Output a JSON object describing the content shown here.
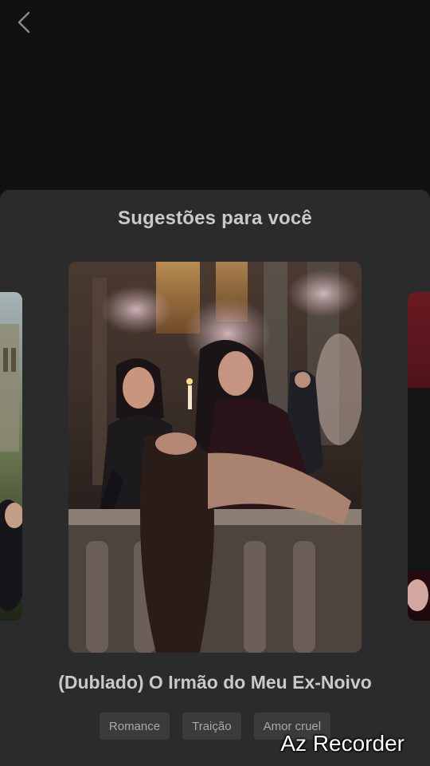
{
  "header": {
    "back_icon": "chevron-left-icon"
  },
  "sheet": {
    "title": "Sugestões para você",
    "featured": {
      "title": "(Dublado) O Irmão do Meu Ex-Noivo",
      "tags": [
        "Romance",
        "Traição",
        "Amor cruel"
      ]
    }
  },
  "overlay": {
    "watermark": "Az Recorder"
  },
  "colors": {
    "background": "#111111",
    "sheet": "#2b2b2c",
    "tag_bg": "#3b3b3c",
    "text": "#c9c9c9"
  }
}
